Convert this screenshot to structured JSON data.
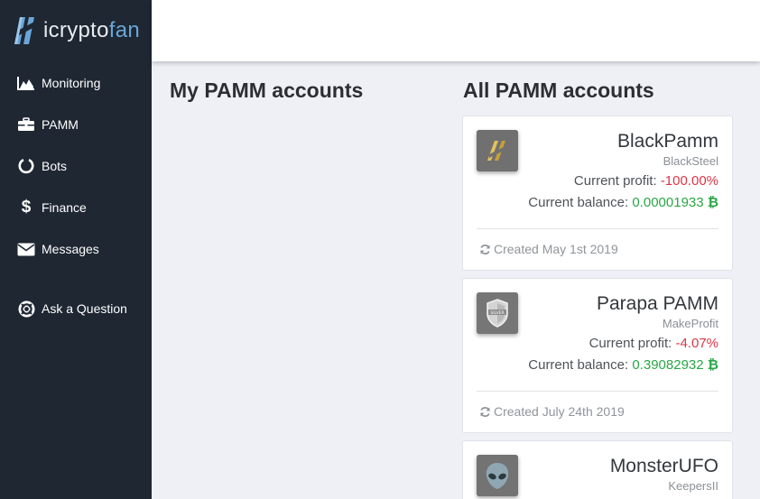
{
  "app": {
    "logo_part1": "icrypto",
    "logo_part2": "fan"
  },
  "sidebar": {
    "items": [
      {
        "label": "Monitoring",
        "icon": "chart-area-icon"
      },
      {
        "label": "PAMM",
        "icon": "briefcase-icon"
      },
      {
        "label": "Bots",
        "icon": "circle-notch-icon"
      },
      {
        "label": "Finance",
        "icon": "dollar-icon"
      },
      {
        "label": "Messages",
        "icon": "envelope-icon"
      },
      {
        "label": "Ask a Question",
        "icon": "life-ring-icon"
      }
    ]
  },
  "main": {
    "my_heading": "My PAMM accounts",
    "all_heading": "All PAMM accounts",
    "profit_label": "Current profit:",
    "balance_label": "Current balance:",
    "currency_symbol": "₿",
    "accounts": [
      {
        "name": "BlackPamm",
        "owner": "BlackSteel",
        "profit": "-100.00%",
        "balance": "0.00001933",
        "created": "Created May 1st 2019",
        "avatar": "gold-stripes-avatar"
      },
      {
        "name": "Parapa PAMM",
        "owner": "MakeProfit",
        "profit": "-4.07%",
        "balance": "0.39082932",
        "created": "Created July 24th 2019",
        "avatar": "silver-shield-avatar",
        "badge": "SILVER"
      },
      {
        "name": "MonsterUFO",
        "owner": "KeepersII",
        "avatar": "alien-avatar"
      }
    ]
  },
  "colors": {
    "sidebar_bg": "#1e2732",
    "page_bg": "#eef0f6",
    "negative": "#dc3545",
    "positive": "#28a745",
    "logo_accent": "#6aa6d8"
  }
}
